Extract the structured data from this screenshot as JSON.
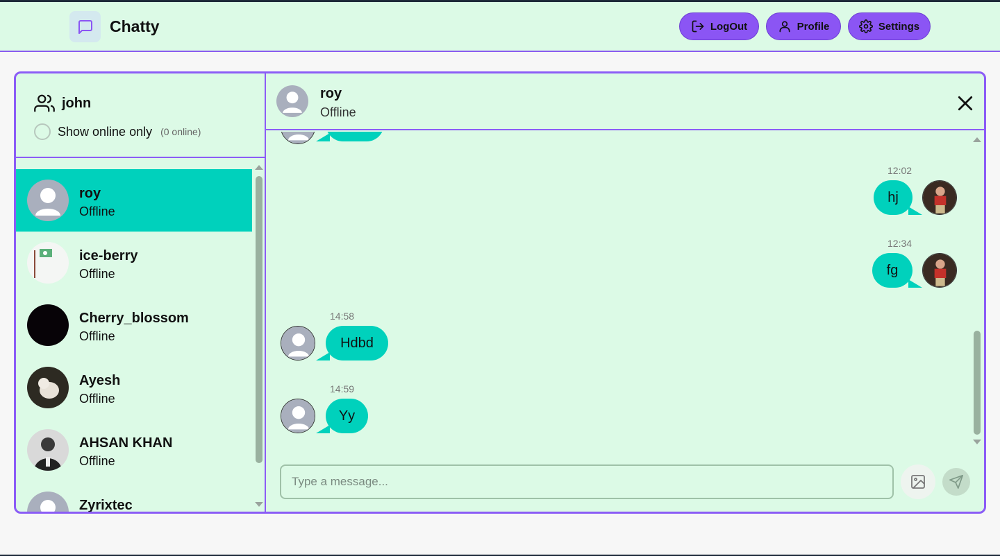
{
  "app": {
    "name": "Chatty"
  },
  "header": {
    "logout_label": "LogOut",
    "profile_label": "Profile",
    "settings_label": "Settings"
  },
  "sidebar": {
    "username": "john",
    "show_online_label": "Show online only",
    "online_count": "(0 online)",
    "contacts": [
      {
        "name": "roy",
        "status": "Offline",
        "selected": true
      },
      {
        "name": "ice-berry",
        "status": "Offline"
      },
      {
        "name": "Cherry_blossom",
        "status": "Offline"
      },
      {
        "name": "Ayesh",
        "status": "Offline"
      },
      {
        "name": "AHSAN KHAN",
        "status": "Offline"
      },
      {
        "name": "Zyrixtec",
        "status": ""
      }
    ]
  },
  "chat": {
    "name": "roy",
    "status": "Offline",
    "messages": [
      {
        "time": "12:02",
        "text": "hj",
        "side": "right"
      },
      {
        "time": "12:34",
        "text": "fg",
        "side": "right"
      },
      {
        "time": "14:58",
        "text": "Hdbd",
        "side": "left"
      },
      {
        "time": "14:59",
        "text": "Yy",
        "side": "left"
      }
    ],
    "input_placeholder": "Type a message..."
  },
  "colors": {
    "accent": "#8b5cf6",
    "bubble": "#00d1bc",
    "panel_bg": "#dcfae6"
  }
}
